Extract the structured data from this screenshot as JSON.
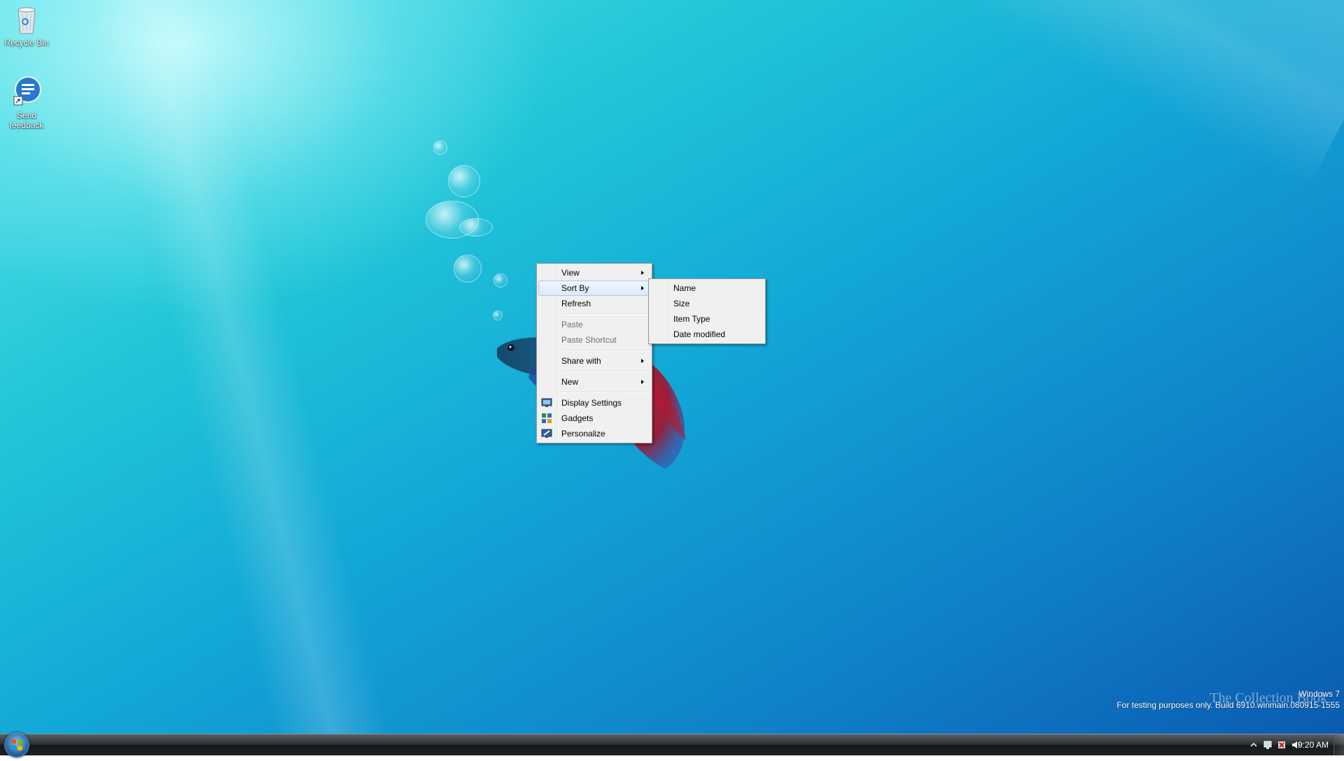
{
  "desktop": {
    "icons": [
      {
        "label": "Recycle Bin",
        "icon": "recycle-bin-icon"
      },
      {
        "label": "Send feedback",
        "icon": "feedback-icon"
      }
    ]
  },
  "context_menu": {
    "items": {
      "view": "View",
      "sort_by": "Sort By",
      "refresh": "Refresh",
      "paste": "Paste",
      "paste_shortcut": "Paste Shortcut",
      "share_with": "Share with",
      "new": "New",
      "display_settings": "Display Settings",
      "gadgets": "Gadgets",
      "personalize": "Personalize"
    },
    "highlighted": "Sort By",
    "disabled": [
      "Paste",
      "Paste Shortcut"
    ]
  },
  "sort_submenu": {
    "items": [
      "Name",
      "Size",
      "Item Type",
      "Date modified"
    ]
  },
  "watermark": {
    "line1": "Windows 7",
    "line2": "For testing purposes only. Build 6910.winmain.080915-1555",
    "overlay": "The Collection Book"
  },
  "taskbar": {
    "clock": "9:20 AM",
    "tray_icons": [
      "show-hidden-icons-arrow",
      "network-icon",
      "action-center-icon",
      "volume-icon"
    ]
  },
  "colors": {
    "menu_background": "#f0f0f0",
    "menu_highlight": "#dce9f9",
    "taskbar": "#1e2226"
  }
}
